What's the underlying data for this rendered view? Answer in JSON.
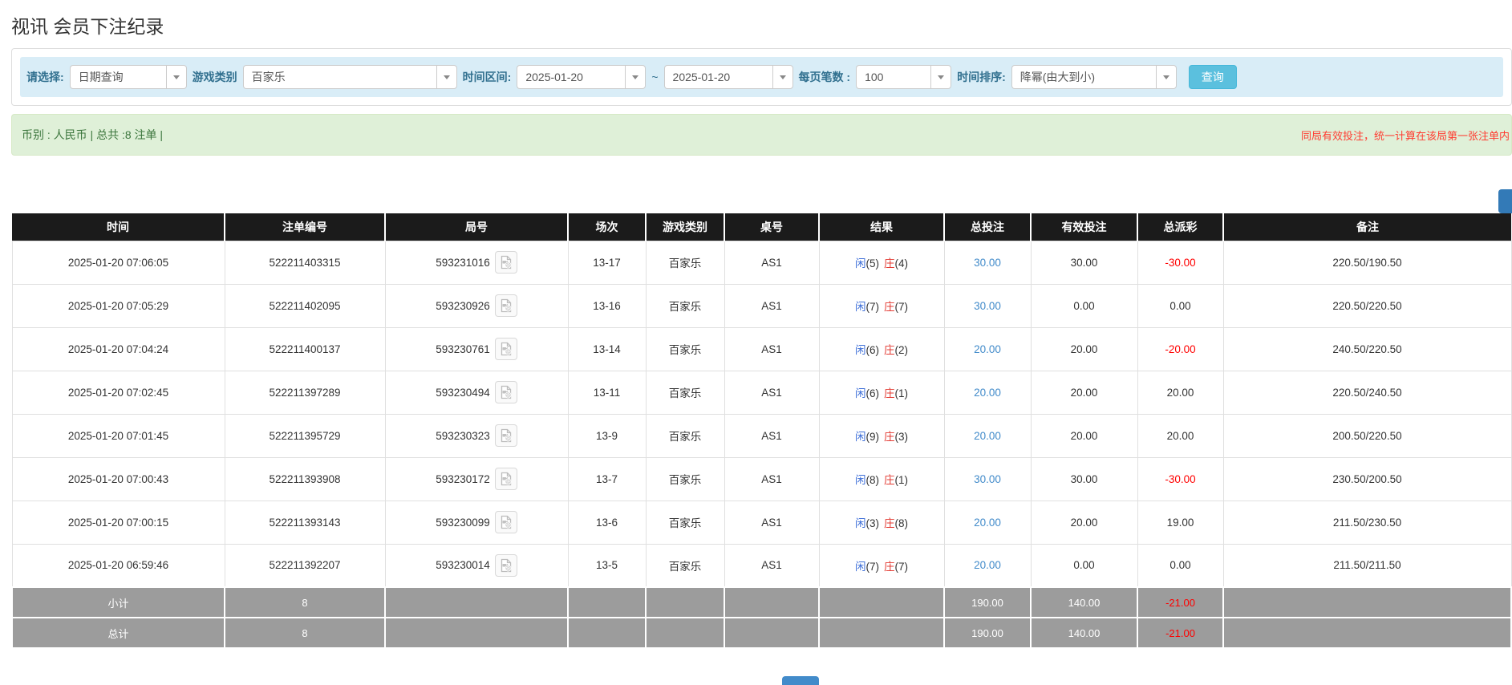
{
  "colors": {
    "accent_button": "#5bc0de",
    "filter_bar": "#d9edf7",
    "summary_bar": "#dff0d8",
    "table_header": "#1b1b1b",
    "footer_gray": "#9c9c9c",
    "link_blue": "#428bca",
    "player_blue": "#3e6fd8",
    "banker_red": "#e33b33",
    "negative_red": "#ff0000"
  },
  "page_title": "视讯 会员下注纪录",
  "filter": {
    "select_label": "请选择:",
    "select_value": "日期查询",
    "game_label": "游戏类别",
    "game_value": "百家乐",
    "range_label": "时间区间:",
    "date_from": "2025-01-20",
    "range_tilde": "~",
    "date_to": "2025-01-20",
    "page_size_label": "每页笔数 :",
    "page_size_value": "100",
    "sort_label": "时间排序:",
    "sort_value": "降幂(由大到小)",
    "search_label": "查询"
  },
  "summary": {
    "currency_info": "币别 : 人民币 | 总共 :8 注单 |",
    "note": "同局有效投注，统一计算在该局第一张注单内"
  },
  "table": {
    "headers": [
      "时间",
      "注单编号",
      "局号",
      "场次",
      "游戏类别",
      "桌号",
      "结果",
      "总投注",
      "有效投注",
      "总派彩",
      "备注"
    ],
    "rows": [
      {
        "time": "2025-01-20 07:06:05",
        "bet_id": "522211403315",
        "round_id": "593231016",
        "session": "13-17",
        "game": "百家乐",
        "table_no": "AS1",
        "result_player": "闲",
        "result_player_pts": "(5)",
        "result_banker": "庄",
        "result_banker_pts": "(4)",
        "total_bet": "30.00",
        "valid_bet": "30.00",
        "payout": "-30.00",
        "remark": "220.50/190.50"
      },
      {
        "time": "2025-01-20 07:05:29",
        "bet_id": "522211402095",
        "round_id": "593230926",
        "session": "13-16",
        "game": "百家乐",
        "table_no": "AS1",
        "result_player": "闲",
        "result_player_pts": "(7)",
        "result_banker": "庄",
        "result_banker_pts": "(7)",
        "total_bet": "30.00",
        "valid_bet": "0.00",
        "payout": "0.00",
        "remark": "220.50/220.50"
      },
      {
        "time": "2025-01-20 07:04:24",
        "bet_id": "522211400137",
        "round_id": "593230761",
        "session": "13-14",
        "game": "百家乐",
        "table_no": "AS1",
        "result_player": "闲",
        "result_player_pts": "(6)",
        "result_banker": "庄",
        "result_banker_pts": "(2)",
        "total_bet": "20.00",
        "valid_bet": "20.00",
        "payout": "-20.00",
        "remark": "240.50/220.50"
      },
      {
        "time": "2025-01-20 07:02:45",
        "bet_id": "522211397289",
        "round_id": "593230494",
        "session": "13-11",
        "game": "百家乐",
        "table_no": "AS1",
        "result_player": "闲",
        "result_player_pts": "(6)",
        "result_banker": "庄",
        "result_banker_pts": "(1)",
        "total_bet": "20.00",
        "valid_bet": "20.00",
        "payout": "20.00",
        "remark": "220.50/240.50"
      },
      {
        "time": "2025-01-20 07:01:45",
        "bet_id": "522211395729",
        "round_id": "593230323",
        "session": "13-9",
        "game": "百家乐",
        "table_no": "AS1",
        "result_player": "闲",
        "result_player_pts": "(9)",
        "result_banker": "庄",
        "result_banker_pts": "(3)",
        "total_bet": "20.00",
        "valid_bet": "20.00",
        "payout": "20.00",
        "remark": "200.50/220.50"
      },
      {
        "time": "2025-01-20 07:00:43",
        "bet_id": "522211393908",
        "round_id": "593230172",
        "session": "13-7",
        "game": "百家乐",
        "table_no": "AS1",
        "result_player": "闲",
        "result_player_pts": "(8)",
        "result_banker": "庄",
        "result_banker_pts": "(1)",
        "total_bet": "30.00",
        "valid_bet": "30.00",
        "payout": "-30.00",
        "remark": "230.50/200.50"
      },
      {
        "time": "2025-01-20 07:00:15",
        "bet_id": "522211393143",
        "round_id": "593230099",
        "session": "13-6",
        "game": "百家乐",
        "table_no": "AS1",
        "result_player": "闲",
        "result_player_pts": "(3)",
        "result_banker": "庄",
        "result_banker_pts": "(8)",
        "total_bet": "20.00",
        "valid_bet": "20.00",
        "payout": "19.00",
        "remark": "211.50/230.50"
      },
      {
        "time": "2025-01-20 06:59:46",
        "bet_id": "522211392207",
        "round_id": "593230014",
        "session": "13-5",
        "game": "百家乐",
        "table_no": "AS1",
        "result_player": "闲",
        "result_player_pts": "(7)",
        "result_banker": "庄",
        "result_banker_pts": "(7)",
        "total_bet": "20.00",
        "valid_bet": "0.00",
        "payout": "0.00",
        "remark": "211.50/211.50"
      }
    ],
    "subtotal": {
      "label": "小计",
      "count": "8",
      "total_bet": "190.00",
      "valid_bet": "140.00",
      "payout": "-21.00"
    },
    "total": {
      "label": "总计",
      "count": "8",
      "total_bet": "190.00",
      "valid_bet": "140.00",
      "payout": "-21.00"
    }
  }
}
